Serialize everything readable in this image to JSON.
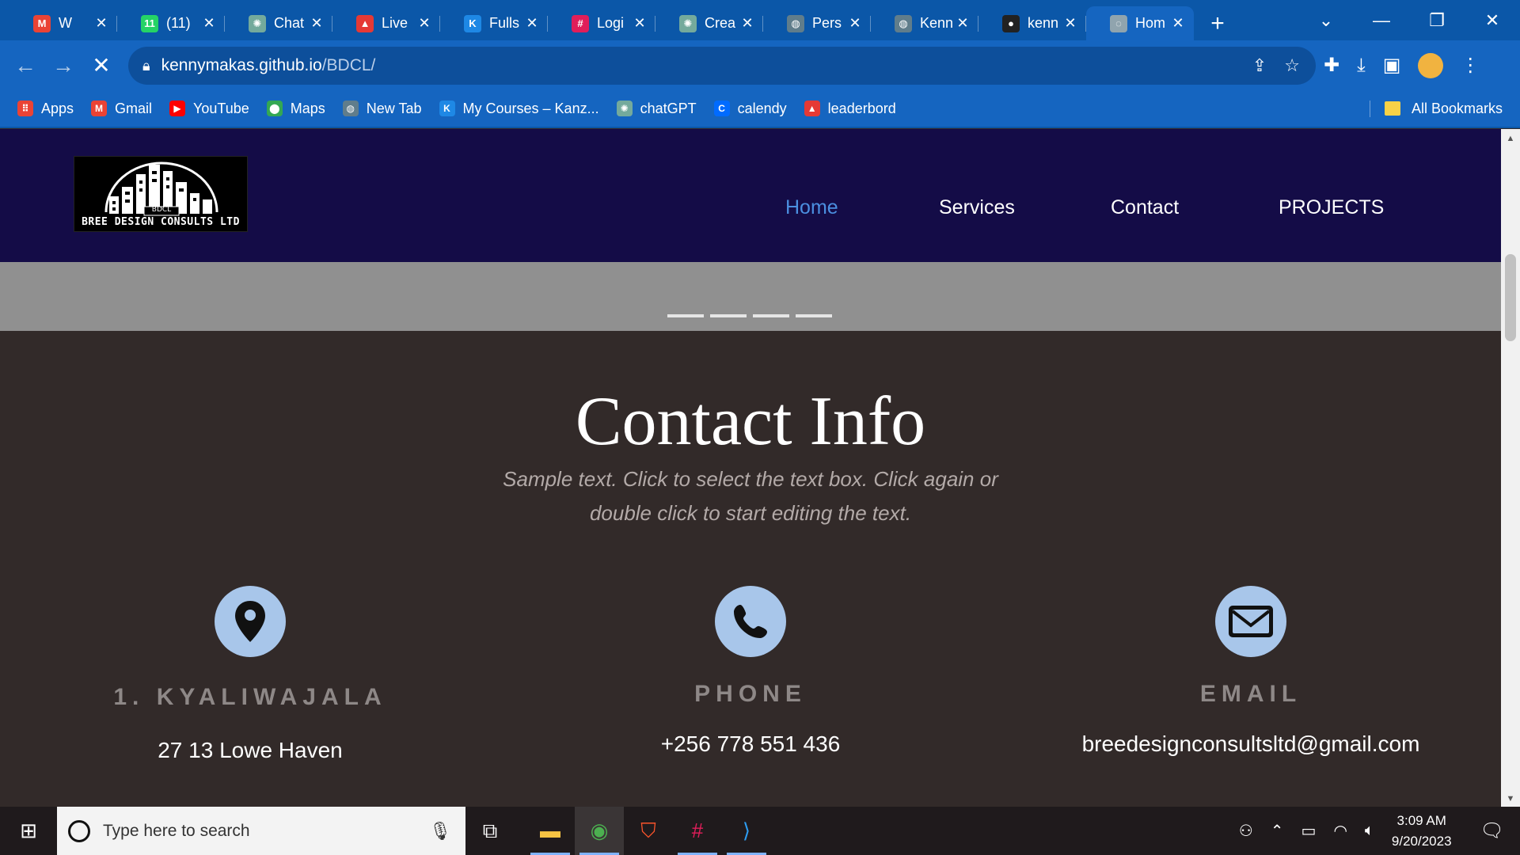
{
  "browser": {
    "tabs": [
      {
        "title": "W",
        "favicon": "gmail-icon",
        "color": "#ea4335",
        "glyph": "M",
        "muted": true
      },
      {
        "title": "(11)",
        "favicon": "whatsapp-icon",
        "color": "#25d366",
        "glyph": "11"
      },
      {
        "title": "Chat",
        "favicon": "chatgpt-icon",
        "color": "#74aa9c",
        "glyph": "✺"
      },
      {
        "title": "Live",
        "favicon": "live-icon",
        "color": "#e53935",
        "glyph": "▲"
      },
      {
        "title": "Fulls",
        "favicon": "kanzu-icon",
        "color": "#1e88e5",
        "glyph": "K"
      },
      {
        "title": "Logi",
        "favicon": "slack-icon",
        "color": "#e01e5a",
        "glyph": "#"
      },
      {
        "title": "Crea",
        "favicon": "chatgpt-icon",
        "color": "#74aa9c",
        "glyph": "✺"
      },
      {
        "title": "Pers",
        "favicon": "globe-icon",
        "color": "#607d8b",
        "glyph": "◍"
      },
      {
        "title": "Kenn",
        "favicon": "globe-icon",
        "color": "#607d8b",
        "glyph": "◍"
      },
      {
        "title": "kenn",
        "favicon": "github-icon",
        "color": "#222222",
        "glyph": "●"
      },
      {
        "title": "Hom",
        "favicon": "loading-icon",
        "color": "#90a4ae",
        "glyph": "◌",
        "active": true
      }
    ],
    "new_tab_glyph": "+",
    "url_host": "kennymakas.github.io",
    "url_path": "/BDCL/",
    "bookmarks": [
      {
        "label": "Apps",
        "icon": "apps-grid-icon",
        "color": "#ea4335",
        "glyph": "⠿"
      },
      {
        "label": "Gmail",
        "icon": "gmail-icon",
        "color": "#ea4335",
        "glyph": "M"
      },
      {
        "label": "YouTube",
        "icon": "youtube-icon",
        "color": "#ff0000",
        "glyph": "▶"
      },
      {
        "label": "Maps",
        "icon": "maps-icon",
        "color": "#34a853",
        "glyph": "⬤"
      },
      {
        "label": "New Tab",
        "icon": "globe-icon",
        "color": "#607d8b",
        "glyph": "◍"
      },
      {
        "label": "My Courses – Kanz...",
        "icon": "kanzu-icon",
        "color": "#1e88e5",
        "glyph": "K"
      },
      {
        "label": "chatGPT",
        "icon": "chatgpt-icon",
        "color": "#74aa9c",
        "glyph": "✺"
      },
      {
        "label": "calendy",
        "icon": "calendly-icon",
        "color": "#006bff",
        "glyph": "C"
      },
      {
        "label": "leaderbord",
        "icon": "live-icon",
        "color": "#e53935",
        "glyph": "▲"
      }
    ],
    "all_bookmarks": "All Bookmarks"
  },
  "site": {
    "logo_text": "BREE DESIGN CONSULTS LTD",
    "logo_badge": "BDCL",
    "nav": [
      {
        "label": "Home",
        "active": true
      },
      {
        "label": "Services"
      },
      {
        "label": "Contact"
      },
      {
        "label": "PROJECTS"
      }
    ],
    "contact": {
      "title": "Contact Info",
      "subtitle": "Sample text. Click to select the text box. Click again or double click to start editing the text.",
      "items": [
        {
          "heading": "1. KYALIWAJALA",
          "value": "27 13 Lowe Haven",
          "icon": "location-pin-icon"
        },
        {
          "heading": "PHONE",
          "value": "+256 778 551 436",
          "icon": "phone-icon"
        },
        {
          "heading": "EMAIL",
          "value": "breedesignconsultsltd@gmail.com",
          "icon": "envelope-icon"
        }
      ]
    }
  },
  "taskbar": {
    "search_placeholder": "Type here to search",
    "time": "3:09 AM",
    "date": "9/20/2023"
  },
  "colors": {
    "header_bg": "#140c47",
    "section_bg": "#322a29",
    "icon_circle": "#a8c6ea",
    "nav_active": "#4b8fe0"
  }
}
